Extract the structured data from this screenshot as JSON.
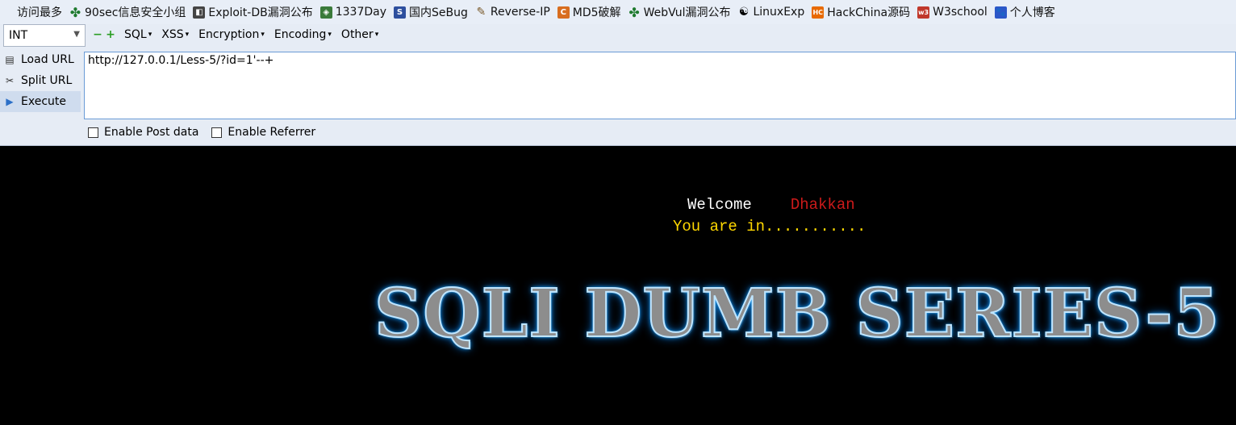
{
  "bookmarks": [
    {
      "icon": "",
      "label": "访问最多"
    },
    {
      "icon": "star-icon",
      "label": "90sec信息安全小组"
    },
    {
      "icon": "doc-icon",
      "label": "Exploit-DB漏洞公布"
    },
    {
      "icon": "green-icon",
      "label": "1337Day"
    },
    {
      "icon": "s-icon",
      "label": "国内SeBug"
    },
    {
      "icon": "pen-icon",
      "label": "Reverse-IP"
    },
    {
      "icon": "c-icon",
      "label": "MD5破解"
    },
    {
      "icon": "star-icon",
      "label": "WebVul漏洞公布"
    },
    {
      "icon": "linux-icon",
      "label": "LinuxExp"
    },
    {
      "icon": "hc-icon",
      "label": "HackChina源码"
    },
    {
      "icon": "w3-icon",
      "label": "W3school"
    },
    {
      "icon": "paw-icon",
      "label": "个人博客"
    }
  ],
  "hackbar": {
    "select_value": "INT",
    "menus": [
      "SQL",
      "XSS",
      "Encryption",
      "Encoding",
      "Other"
    ],
    "side": {
      "load": "Load URL",
      "split": "Split URL",
      "execute": "Execute"
    },
    "url": "http://127.0.0.1/Less-5/?id=1'--+",
    "post_label": "Enable Post data",
    "referrer_label": "Enable Referrer"
  },
  "page": {
    "welcome": "Welcome",
    "name": "Dhakkan",
    "status": "You are in...........",
    "banner": "SQLI DUMB SERIES-5"
  }
}
